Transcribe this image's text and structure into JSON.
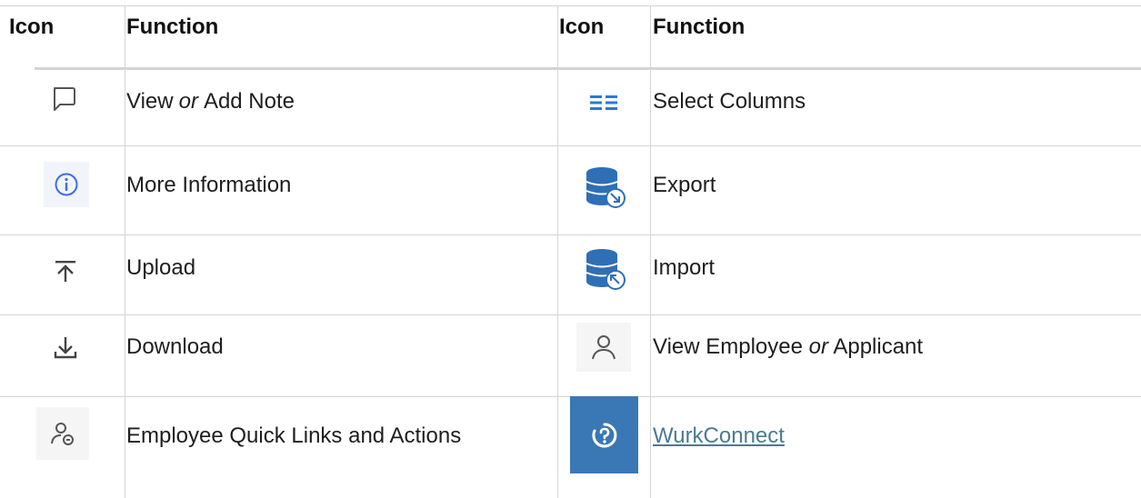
{
  "table": {
    "headers": {
      "icon_left": "Icon",
      "function_left": "Function",
      "icon_right": "Icon",
      "function_right": "Function"
    },
    "rows": [
      {
        "left": {
          "icon": "speech-bubble-note-icon",
          "label_pre": "View ",
          "label_em": "or",
          "label_post": " Add Note"
        },
        "right": {
          "icon": "columns-list-icon",
          "label": "Select Columns"
        }
      },
      {
        "left": {
          "icon": "info-circle-icon",
          "label": "More Information"
        },
        "right": {
          "icon": "database-export-icon",
          "label": "Export"
        }
      },
      {
        "left": {
          "icon": "upload-arrow-icon",
          "label": "Upload"
        },
        "right": {
          "icon": "database-import-icon",
          "label": "Import"
        }
      },
      {
        "left": {
          "icon": "download-arrow-icon",
          "label": "Download"
        },
        "right": {
          "icon": "person-icon",
          "label_pre": "View Employee ",
          "label_em": "or",
          "label_post": " Applicant"
        }
      },
      {
        "left": {
          "icon": "person-link-icon",
          "label": "Employee Quick Links and Actions"
        },
        "right": {
          "icon": "wurkconnect-icon",
          "label": "WurkConnect"
        }
      }
    ]
  },
  "colors": {
    "grid_line": "#d4d4d4",
    "link": "#4a7b94",
    "db_blue": "#2f6fb5",
    "wurk_tile": "#3a78b5",
    "info_blue": "#3d6bf2"
  }
}
